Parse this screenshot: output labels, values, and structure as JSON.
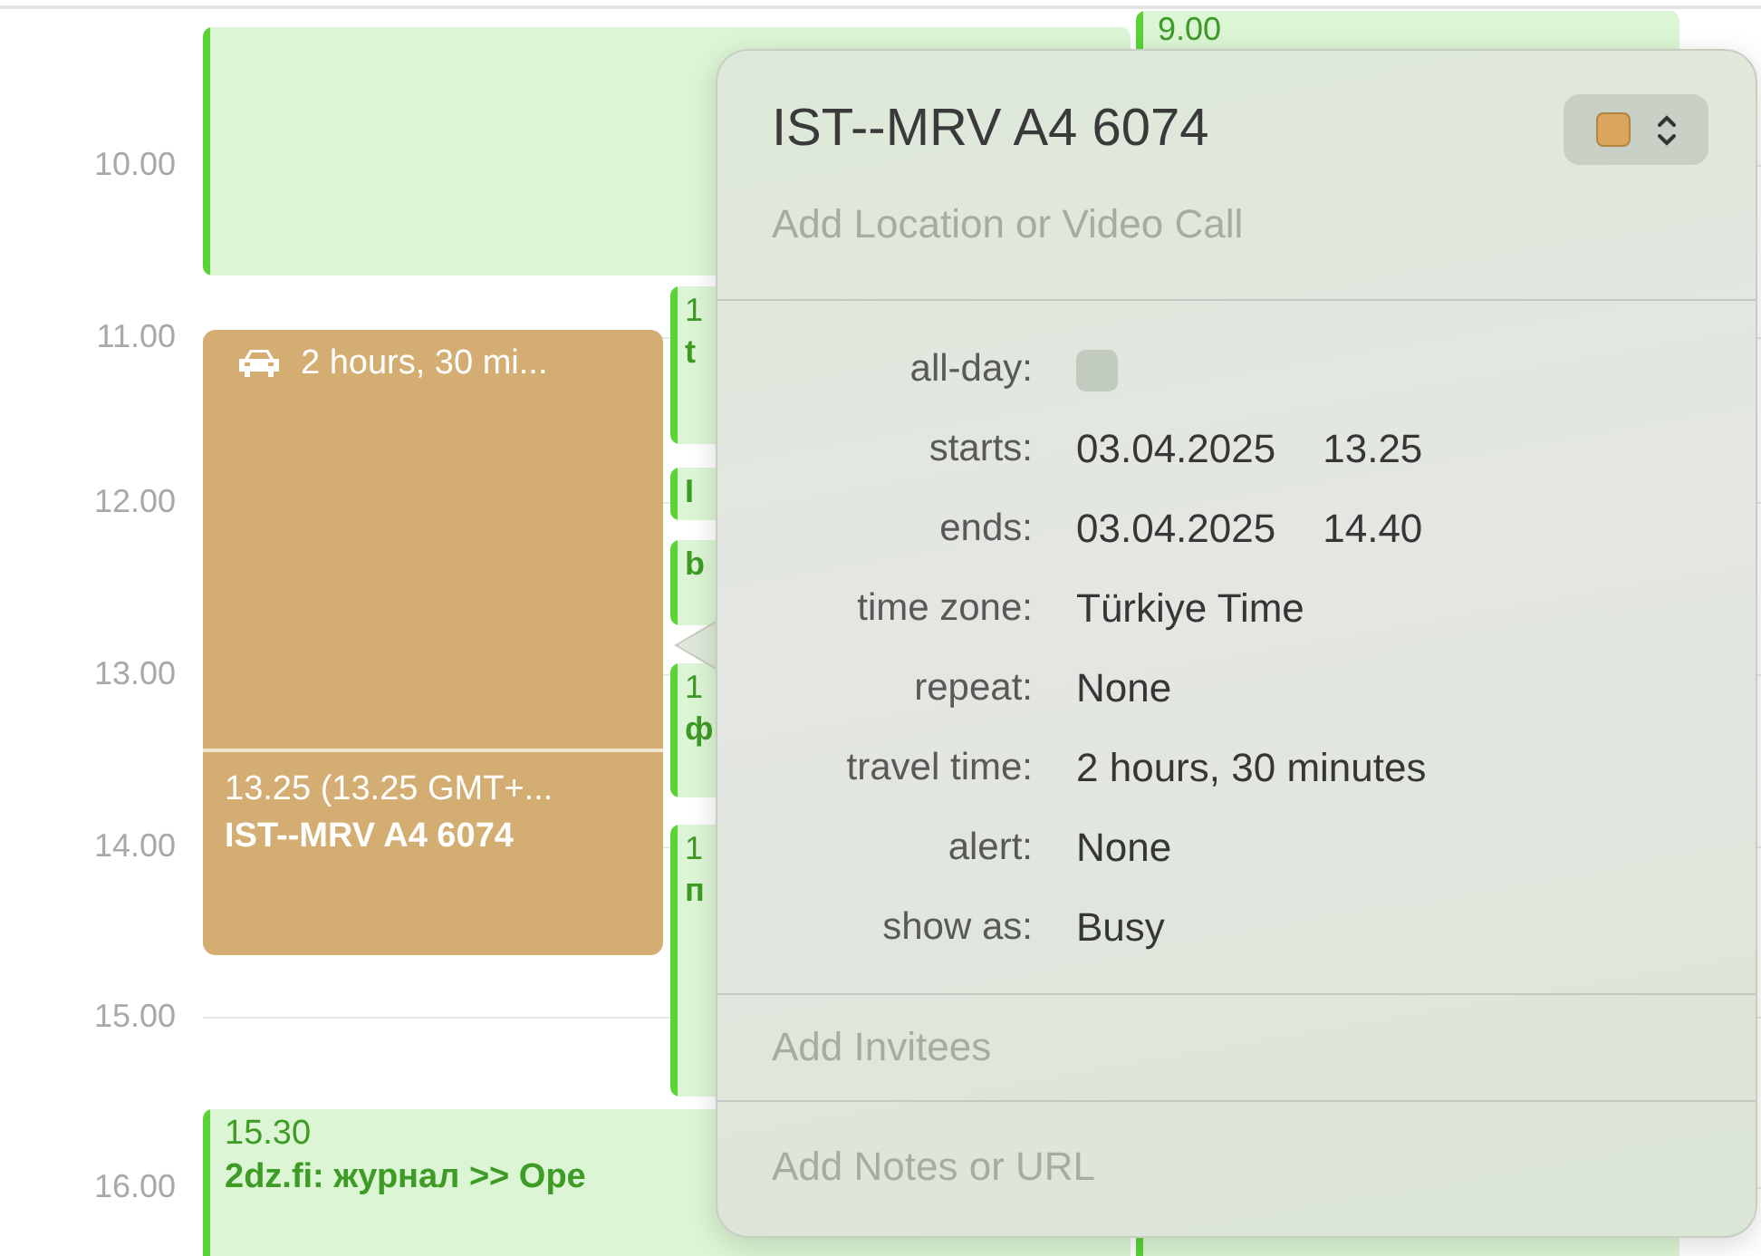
{
  "time_labels": [
    "10.00",
    "11.00",
    "12.00",
    "13.00",
    "14.00",
    "15.00",
    "16.00"
  ],
  "events": [
    {
      "kind": "event",
      "color": "#5ad336"
    },
    {
      "kind": "travel_event",
      "color": "#d4ad72",
      "travel": "2 hours, 30 mi...",
      "time": "13.25 (13.25 GMT+...",
      "title": "IST--MRV A4 6074"
    },
    {
      "kind": "event",
      "color": "#5ad336",
      "time": "1",
      "title": "t"
    },
    {
      "kind": "event",
      "color": "#5ad336",
      "title": "I"
    },
    {
      "kind": "event",
      "color": "#5ad336",
      "title": "b"
    },
    {
      "kind": "event",
      "color": "#5ad336",
      "time": "1",
      "title": "ф"
    },
    {
      "kind": "event",
      "color": "#5ad336",
      "time": "1",
      "title": "п"
    },
    {
      "kind": "event",
      "color": "#5ad336",
      "time": "15.30",
      "title": "2dz.fi: журнал >> Ope"
    },
    {
      "kind": "event",
      "color": "#5ad336",
      "time": "9.00"
    }
  ],
  "popover": {
    "title": "IST--MRV A4 6074",
    "color_menu": {
      "color": "#d9a55f"
    },
    "location": {
      "placeholder": "Add Location or Video Call"
    },
    "fields": [
      {
        "kind": "checkbox",
        "label": "all-day:",
        "checked": false
      },
      {
        "kind": "datetime",
        "label": "starts:",
        "date": "03.04.2025",
        "time": "13.25"
      },
      {
        "kind": "datetime",
        "label": "ends:",
        "date": "03.04.2025",
        "time": "14.40"
      },
      {
        "kind": "text",
        "label": "time zone:",
        "value": "Türkiye Time"
      },
      {
        "kind": "text",
        "label": "repeat:",
        "value": "None"
      },
      {
        "kind": "text",
        "label": "travel time:",
        "value": "2 hours, 30 minutes"
      },
      {
        "kind": "text",
        "label": "alert:",
        "value": "None"
      },
      {
        "kind": "text",
        "label": "show as:",
        "value": "Busy"
      }
    ],
    "invitees": {
      "placeholder": "Add Invitees"
    },
    "notes": {
      "placeholder": "Add Notes or URL"
    }
  }
}
